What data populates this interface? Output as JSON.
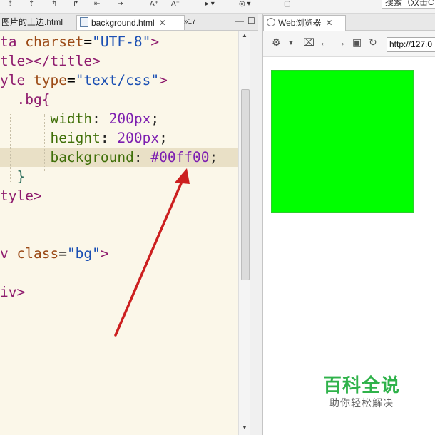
{
  "toolbar": {
    "icons": [
      "tool-icon-1",
      "tool-icon-2",
      "tool-icon-3",
      "tool-icon-4",
      "tool-icon-5",
      "tool-icon-6",
      "font-increase-icon",
      "font-decrease-icon",
      "run-icon",
      "globe-icon",
      "tool-icon-7"
    ],
    "search_text": "搜索（双击C"
  },
  "editor": {
    "tabs": {
      "first": "图片的上边.html",
      "active": "background.html",
      "overflow": "»17"
    },
    "code_lines": [
      [
        {
          "t": "ta ",
          "c": "tag"
        },
        {
          "t": "charset",
          "c": "attr"
        },
        {
          "t": "=",
          "c": "eq"
        },
        {
          "t": "\"UTF-8\"",
          "c": "str"
        },
        {
          "t": ">",
          "c": "tag"
        }
      ],
      [
        {
          "t": "tle></title>",
          "c": "tag"
        }
      ],
      [
        {
          "t": "yle ",
          "c": "tag"
        },
        {
          "t": "type",
          "c": "attr"
        },
        {
          "t": "=",
          "c": "eq"
        },
        {
          "t": "\"text/css\"",
          "c": "str"
        },
        {
          "t": ">",
          "c": "tag"
        }
      ],
      [
        {
          "t": "  .bg{",
          "c": "sel"
        }
      ],
      [
        {
          "t": "      ",
          "c": "punct"
        },
        {
          "t": "width",
          "c": "prop"
        },
        {
          "t": ": ",
          "c": "punct"
        },
        {
          "t": "200px",
          "c": "val"
        },
        {
          "t": ";",
          "c": "punct"
        }
      ],
      [
        {
          "t": "      ",
          "c": "punct"
        },
        {
          "t": "height",
          "c": "prop"
        },
        {
          "t": ": ",
          "c": "punct"
        },
        {
          "t": "200px",
          "c": "val"
        },
        {
          "t": ";",
          "c": "punct"
        }
      ],
      [
        {
          "t": "      ",
          "c": "punct"
        },
        {
          "t": "background",
          "c": "prop"
        },
        {
          "t": ": ",
          "c": "punct"
        },
        {
          "t": "#00ff00",
          "c": "val"
        },
        {
          "t": ";",
          "c": "punct"
        }
      ],
      [
        {
          "t": "  }",
          "c": "brace"
        }
      ],
      [
        {
          "t": "tyle>",
          "c": "tag"
        }
      ],
      [],
      [],
      [
        {
          "t": "v ",
          "c": "tag"
        },
        {
          "t": "class",
          "c": "attr"
        },
        {
          "t": "=",
          "c": "eq"
        },
        {
          "t": "\"bg\"",
          "c": "str"
        },
        {
          "t": ">",
          "c": "tag"
        }
      ],
      [],
      [
        {
          "t": "iv>",
          "c": "tag"
        }
      ]
    ],
    "highlighted_line": 7
  },
  "browser": {
    "tab_label": "Web浏览器",
    "url": "http://127.0",
    "box_color": "#00ff00",
    "nav_icons": [
      "settings-icon",
      "dropdown-icon",
      "console-icon",
      "back-icon",
      "forward-icon",
      "stop-icon",
      "refresh-icon"
    ]
  },
  "watermark": {
    "title": "百科全说",
    "subtitle": "助你轻松解决"
  },
  "colors": {
    "editor_bg": "#fbf7e9",
    "highlight": "#e9e0c6",
    "arrow": "#cc1f1f",
    "watermark_green": "#2fb24a"
  }
}
